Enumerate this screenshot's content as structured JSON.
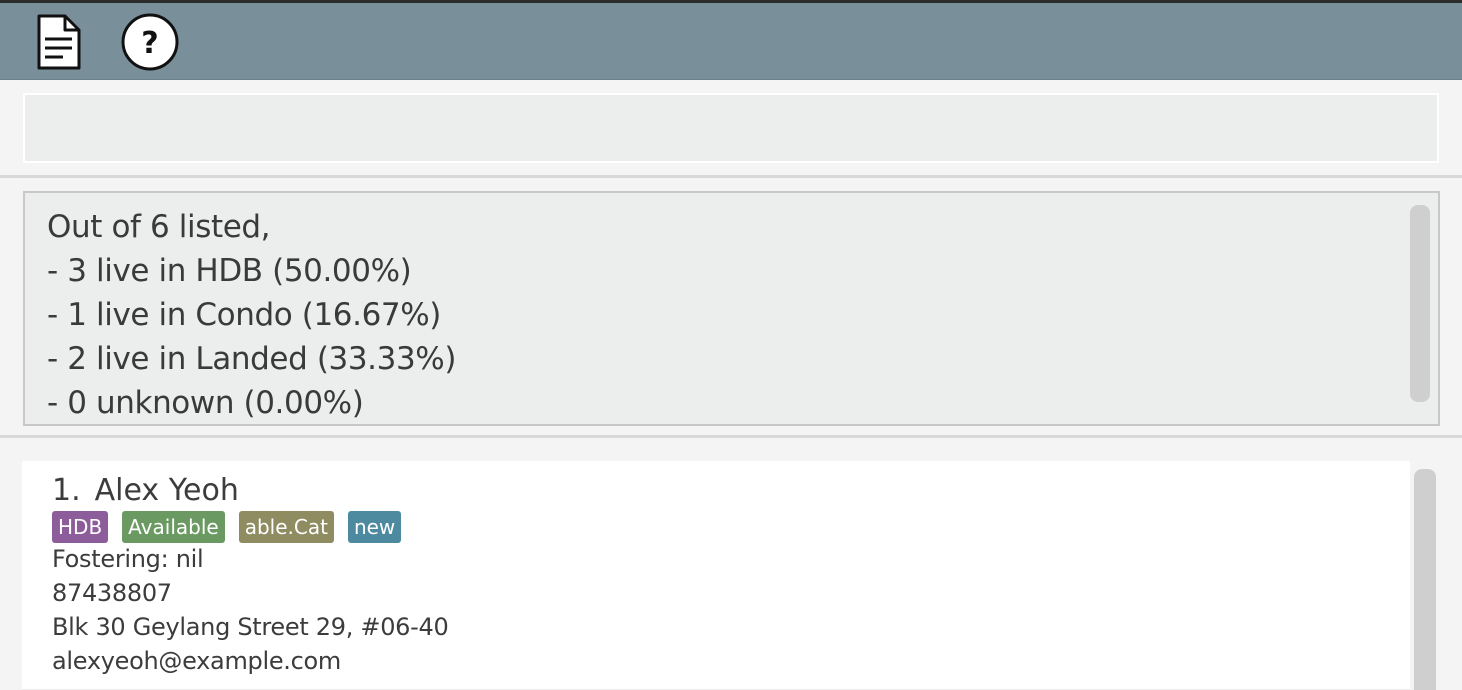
{
  "toolbar": {
    "buttons": [
      {
        "icon": "document-icon",
        "tooltip": ""
      },
      {
        "icon": "help-icon",
        "glyph": "?"
      }
    ],
    "background_color": "#798f9a"
  },
  "command_box": {
    "value": "",
    "placeholder": ""
  },
  "result_display": {
    "lines": [
      "Out of 6 listed,",
      "- 3 live in HDB (50.00%)",
      "- 1 live in Condo (16.67%)",
      "- 2 live in Landed (33.33%)",
      "- 0 unknown (0.00%)"
    ]
  },
  "person_list": {
    "persons": [
      {
        "index": "1.",
        "name": "Alex Yeoh",
        "tags": [
          {
            "label": "HDB",
            "color": "#8d5c9a"
          },
          {
            "label": "Available",
            "color": "#6a9a62"
          },
          {
            "label": "able.Cat",
            "color": "#8f8c62"
          },
          {
            "label": "new",
            "color": "#4d8aa0"
          }
        ],
        "fostering": "Fostering: nil",
        "phone": "87438807",
        "address": "Blk 30 Geylang Street 29, #06-40",
        "email": "alexyeoh@example.com"
      }
    ]
  }
}
